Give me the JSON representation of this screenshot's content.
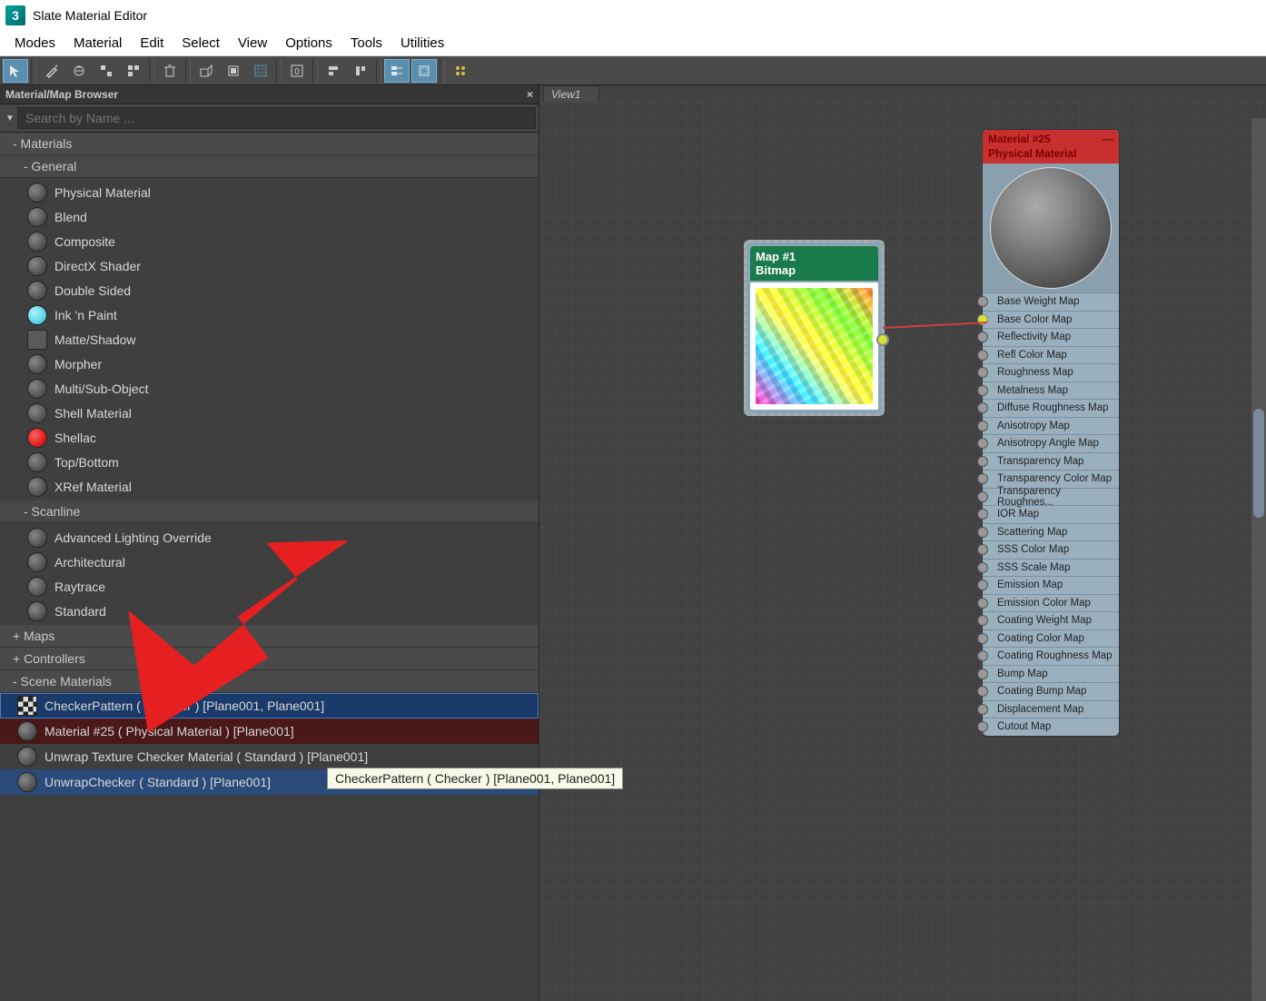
{
  "window": {
    "title": "Slate Material Editor"
  },
  "menubar": [
    "Modes",
    "Material",
    "Edit",
    "Select",
    "View",
    "Options",
    "Tools",
    "Utilities"
  ],
  "browser": {
    "title": "Material/Map Browser",
    "search_placeholder": "Search by Name ...",
    "materials_header": "- Materials",
    "general_header": "  - General",
    "general_items": [
      {
        "label": "Physical Material",
        "icon": "sphere"
      },
      {
        "label": "Blend",
        "icon": "sphere"
      },
      {
        "label": "Composite",
        "icon": "sphere"
      },
      {
        "label": "DirectX Shader",
        "icon": "sphere"
      },
      {
        "label": "Double Sided",
        "icon": "sphere"
      },
      {
        "label": "Ink 'n Paint",
        "icon": "cyan"
      },
      {
        "label": "Matte/Shadow",
        "icon": "matte"
      },
      {
        "label": "Morpher",
        "icon": "sphere"
      },
      {
        "label": "Multi/Sub-Object",
        "icon": "sphere"
      },
      {
        "label": "Shell Material",
        "icon": "sphere"
      },
      {
        "label": "Shellac",
        "icon": "red"
      },
      {
        "label": "Top/Bottom",
        "icon": "sphere"
      },
      {
        "label": "XRef Material",
        "icon": "sphere"
      }
    ],
    "scanline_header": "  - Scanline",
    "scanline_items": [
      {
        "label": "Advanced Lighting Override"
      },
      {
        "label": "Architectural"
      },
      {
        "label": "Raytrace"
      },
      {
        "label": "Standard"
      }
    ],
    "maps_header": "+ Maps",
    "controllers_header": "+ Controllers",
    "scene_header": " - Scene Materials",
    "scene_items": [
      {
        "label": "CheckerPattern  ( Checker )  [Plane001, Plane001]",
        "icon": "checker",
        "sel": "wrap"
      },
      {
        "label": "Material #25  ( Physical Material )  [Plane001]",
        "icon": "sphere",
        "sel": "maroon"
      },
      {
        "label": "Unwrap Texture Checker Material  ( Standard )  [Plane001]",
        "icon": "sphere",
        "sel": ""
      },
      {
        "label": "UnwrapChecker  ( Standard )  [Plane001]",
        "icon": "sphere",
        "sel": "blue"
      }
    ]
  },
  "view": {
    "tab": "View1",
    "map_node": {
      "title": "Map #1",
      "subtitle": "Bitmap"
    },
    "mat_node": {
      "title": "Material #25",
      "subtitle": "Physical Material",
      "slots": [
        "Base Weight Map",
        "Base Color Map",
        "Reflectivity Map",
        "Refl Color Map",
        "Roughness Map",
        "Metalness Map",
        "Diffuse Roughness Map",
        "Anisotropy Map",
        "Anisotropy Angle Map",
        "Transparency Map",
        "Transparency Color Map",
        "Transparency Roughnes...",
        "IOR Map",
        "Scattering Map",
        "SSS Color Map",
        "SSS Scale Map",
        "Emission Map",
        "Emission Color Map",
        "Coating Weight Map",
        "Coating Color Map",
        "Coating Roughness Map",
        "Bump Map",
        "Coating Bump Map",
        "Displacement Map",
        "Cutout Map"
      ],
      "connected_index": 1
    }
  },
  "tooltip": "CheckerPattern  ( Checker )  [Plane001, Plane001]"
}
